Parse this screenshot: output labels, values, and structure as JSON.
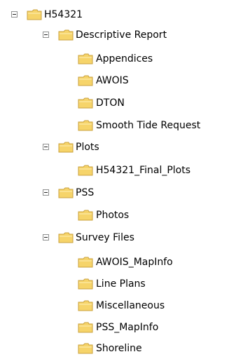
{
  "tree": [
    {
      "label": "H54321",
      "expanded": true,
      "depth": 0
    },
    {
      "label": "Descriptive Report",
      "expanded": true,
      "depth": 1
    },
    {
      "label": "Appendices",
      "depth": 2
    },
    {
      "label": "AWOIS",
      "depth": 2
    },
    {
      "label": "DTON",
      "depth": 2
    },
    {
      "label": "Smooth Tide Request",
      "depth": 2
    },
    {
      "label": "Plots",
      "expanded": true,
      "depth": 1
    },
    {
      "label": "H54321_Final_Plots",
      "depth": 2
    },
    {
      "label": "PSS",
      "expanded": true,
      "depth": 1
    },
    {
      "label": "Photos",
      "depth": 2
    },
    {
      "label": "Survey Files",
      "expanded": true,
      "depth": 1
    },
    {
      "label": "AWOIS_MapInfo",
      "depth": 2
    },
    {
      "label": "Line Plans",
      "depth": 2
    },
    {
      "label": "Miscellaneous",
      "depth": 2
    },
    {
      "label": "PSS_MapInfo",
      "depth": 2
    },
    {
      "label": "Shoreline",
      "depth": 2
    }
  ],
  "colors": {
    "folder_fill": "#f6d46a",
    "folder_edge": "#c9a13d",
    "folder_light": "#fff1b8"
  }
}
